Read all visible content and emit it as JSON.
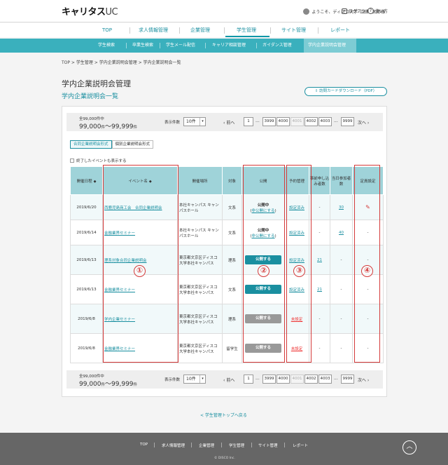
{
  "header": {
    "logo": "キャリタス",
    "logo_suffix": "UC",
    "welcome": "ようこそ、ディスコ大学",
    "user_name": "山田　太郎様",
    "logout": "ログアウト",
    "help": "使い方"
  },
  "main_nav": [
    "TOP",
    "求人情報管理",
    "企業管理",
    "学生管理",
    "サイト管理",
    "レポート"
  ],
  "sub_nav": [
    "学生検索",
    "卒業生検索",
    "学生メール配信",
    "キャリア相談管理",
    "ガイダンス管理",
    "学内企業説明会管理"
  ],
  "breadcrumb": "TOP > 学生管理 > 学内企業説明会管理 > 学内企業説明会一覧",
  "page_title": "学内企業説明会管理",
  "page_subtitle": "学内企業説明会一覧",
  "download_button": "訪問カードダウンロード（PDF）",
  "pager": {
    "total_label": "全99,000件中",
    "range_from": "99,000",
    "range_to": "99,999",
    "unit": "件",
    "tilde": "～",
    "perpage_label": "表示件数",
    "perpage_value": "10件",
    "prev": "前へ",
    "next": "次へ",
    "ellipsis": "...",
    "pages": [
      "1",
      "3999",
      "4000",
      "4001",
      "4002",
      "4003",
      "9999"
    ],
    "current_page": "4001"
  },
  "tabs": [
    "合同企業説明会形式",
    "個別企業説明会形式"
  ],
  "show_finished": "終了したイベントも表示する",
  "table": {
    "headers": {
      "date": "開催日程",
      "event": "イベント名",
      "place": "開催場所",
      "target": "対象",
      "public": "公開",
      "reservation": "予約管理",
      "pre_count": "事前申し込み者数",
      "day_count": "当日参加者数",
      "fixed": "定員設定"
    },
    "rows": [
      {
        "date": "2019/6/20",
        "event": "西鹿児島商工会　合同企業説明会",
        "place": "本社キャンパス キャンパスホール",
        "target": "文系",
        "public_status": "公開中",
        "public_action": "非公開にする",
        "reservation": "設定済み",
        "pre_count": "-",
        "day_count": "30",
        "fixed": "edit"
      },
      {
        "date": "2019/6/14",
        "event": "金融業界セミナー",
        "place": "本社キャンパス キャンパスホール",
        "target": "文系",
        "public_status": "公開中",
        "public_action": "非公開にする",
        "reservation": "設定済み",
        "pre_count": "-",
        "day_count": "40",
        "fixed": "-"
      },
      {
        "date": "2019/6/13",
        "event": "理系対象合同企業説明会",
        "place": "東京都文京区ディスコ大学本社キャンパス",
        "target": "理系",
        "public_button": "公開する",
        "reservation": "設定済み",
        "pre_count": "21",
        "day_count": "-",
        "fixed": "-"
      },
      {
        "date": "2019/6/13",
        "event": "金融業界セミナー",
        "place": "東京都文京区ディスコ大学本社キャンパス",
        "target": "文系",
        "public_button": "公開する",
        "reservation": "設定済み",
        "pre_count": "21",
        "day_count": "-",
        "fixed": "-"
      },
      {
        "date": "2019/6/8",
        "event": "学内企業セミナー",
        "place": "東京都文京区ディスコ大学本社キャンパス",
        "target": "理系",
        "public_button": "公開する",
        "reservation": "未設定",
        "pre_count": "-",
        "day_count": "-",
        "fixed": "-"
      },
      {
        "date": "2019/6/8",
        "event": "金融業界セミナー",
        "place": "東京都文京区ディスコ大学本社キャンパス",
        "target": "留学生",
        "public_button": "公開する",
        "reservation": "未設定",
        "pre_count": "-",
        "day_count": "-",
        "fixed": "-"
      }
    ]
  },
  "markers": [
    "①",
    "②",
    "③",
    "④"
  ],
  "back_link": "< 学生管理トップへ戻る",
  "footer": {
    "nav": [
      "TOP",
      "求人情報管理",
      "企業管理",
      "学生管理",
      "サイト管理",
      "レポート"
    ],
    "copyright": "© DISCO Inc."
  },
  "colors": {
    "accent": "#1a8fa0",
    "subnav": "#3ab0bd",
    "highlight": "#d43a3a",
    "unset": "#e33333"
  }
}
